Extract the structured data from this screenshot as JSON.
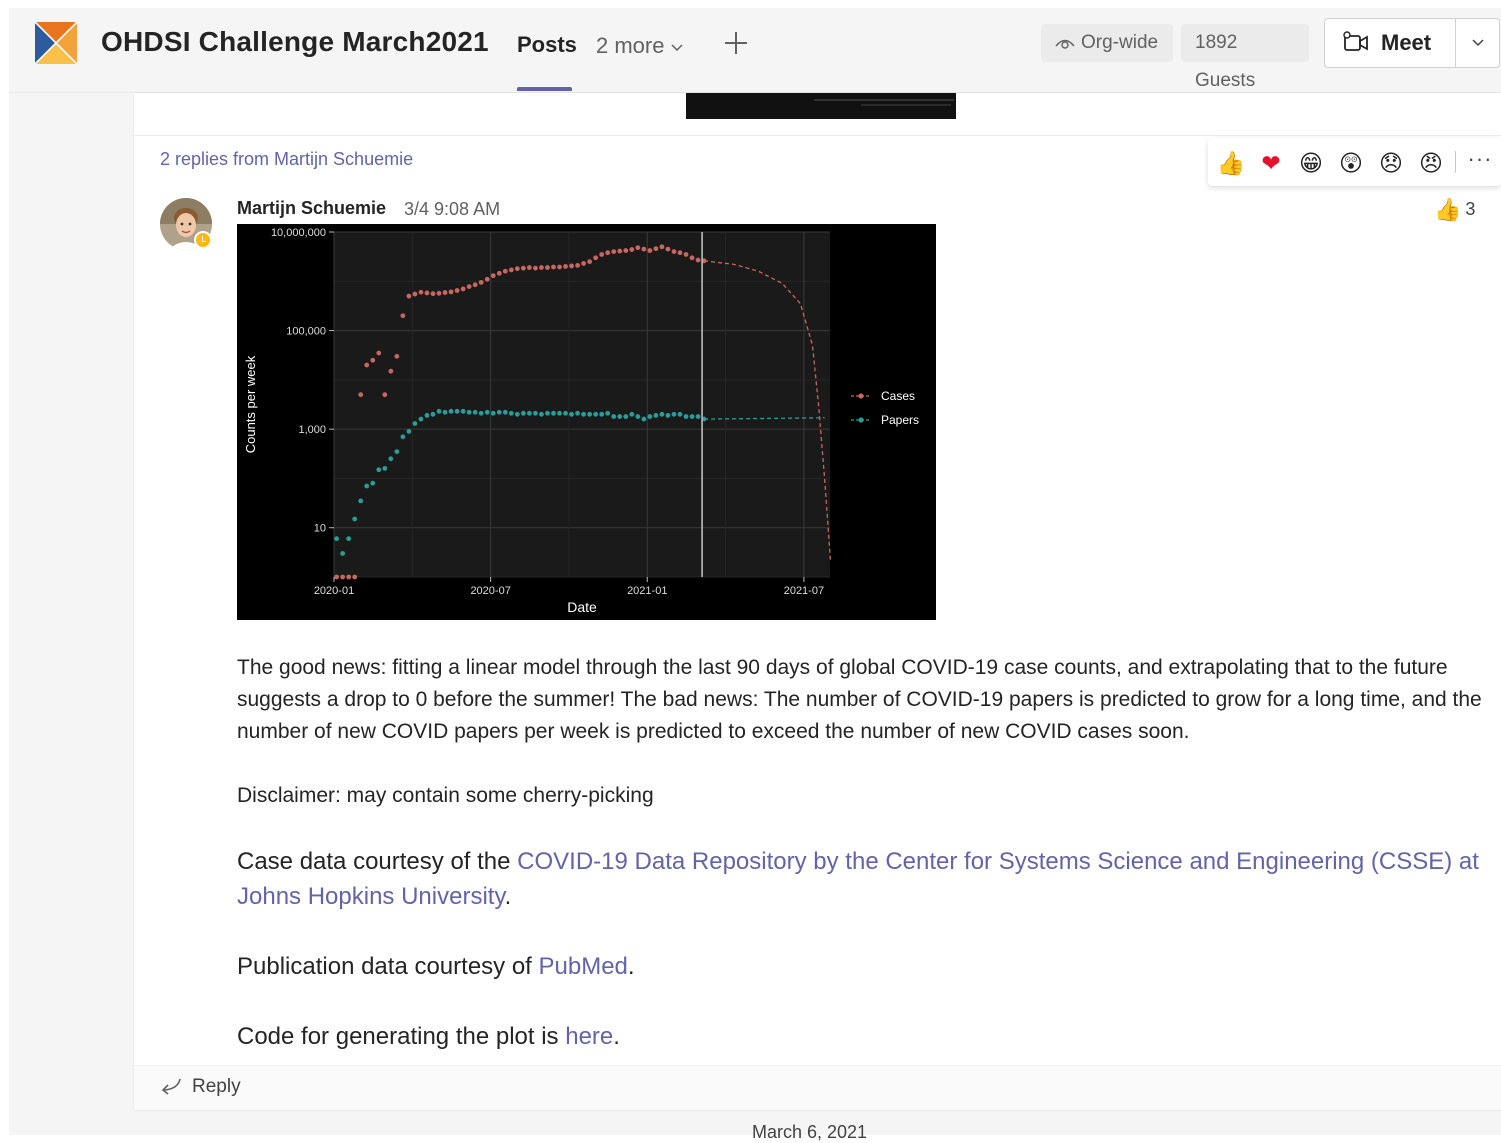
{
  "header": {
    "team_name": "OHDSI Challenge March2021",
    "tab_posts": "Posts",
    "tab_more": "2 more",
    "org_wide": "Org-wide",
    "guests": "1892 Guests",
    "meet_label": "Meet",
    "accent_color": "#6264a7"
  },
  "thread": {
    "replies_link": "2 replies from Martijn Schuemie",
    "reactions": [
      "thumbs-up",
      "heart",
      "laugh",
      "surprised",
      "sad",
      "angry"
    ],
    "message": {
      "author": "Martijn Schuemie",
      "timestamp": "3/4 9:08 AM",
      "like_count": "3",
      "paragraph1": "The good news: fitting a linear model through the last 90 days of global COVID-19 case counts, and extrapolating that to the future suggests a drop to 0 before the summer! The bad news: The number of COVID-19 papers is predicted to grow for a long time, and the number of new COVID papers per week is predicted to exceed the number of new COVID cases soon.",
      "disclaimer": "Disclaimer: may contain some cherry-picking",
      "case_prefix": "Case data courtesy of the ",
      "case_link": "COVID-19 Data Repository by the Center for Systems Science and Engineering (CSSE) at Johns Hopkins University",
      "case_suffix": ".",
      "pub_prefix": "Publication data courtesy of ",
      "pub_link": "PubMed",
      "pub_suffix": ".",
      "code_prefix": "Code for generating the plot is ",
      "code_link": "here",
      "code_suffix": "."
    },
    "reply_label": "Reply"
  },
  "date_divider": "March 6, 2021",
  "chart_data": {
    "type": "scatter",
    "xlabel": "Date",
    "ylabel": "Counts per week",
    "y_scale": "log10",
    "ylim": [
      1,
      10000000
    ],
    "xlim": [
      "2020-01",
      "2021-08"
    ],
    "x_ticks": [
      "2020-01",
      "2020-07",
      "2021-01",
      "2021-07"
    ],
    "y_ticks": [
      {
        "value": 10,
        "label": "10"
      },
      {
        "value": 1000,
        "label": "1,000"
      },
      {
        "value": 100000,
        "label": "100,000"
      },
      {
        "value": 10000000,
        "label": "10,000,000"
      }
    ],
    "vline": "2021-03-04",
    "legend_position": "right",
    "background": "#000000",
    "panel_color": "#1a1a1a",
    "grid": true,
    "series": [
      {
        "name": "Cases",
        "color": "#c8675f",
        "weeks": [
          0,
          1,
          2,
          3,
          4,
          5,
          6,
          7,
          8,
          9,
          10,
          11,
          12,
          13,
          14,
          15,
          16,
          17,
          18,
          19,
          20,
          21,
          22,
          23,
          24,
          25,
          26,
          27,
          28,
          29,
          30,
          31,
          32,
          33,
          34,
          35,
          36,
          37,
          38,
          39,
          40,
          41,
          42,
          43,
          44,
          45,
          46,
          47,
          48,
          49,
          50,
          51,
          52,
          53,
          54,
          55,
          56,
          57,
          58,
          59,
          60,
          61
        ],
        "values": [
          1,
          1,
          1,
          1,
          5000,
          20000,
          25000,
          35000,
          5000,
          15000,
          30000,
          200000,
          500000,
          550000,
          600000,
          580000,
          560000,
          570000,
          590000,
          610000,
          650000,
          700000,
          780000,
          850000,
          950000,
          1100000,
          1300000,
          1450000,
          1600000,
          1700000,
          1800000,
          1850000,
          1900000,
          1850000,
          1900000,
          1900000,
          1950000,
          1950000,
          2000000,
          2050000,
          2100000,
          2300000,
          2500000,
          3000000,
          3500000,
          3800000,
          4000000,
          4100000,
          4200000,
          4400000,
          4800000,
          4500000,
          4200000,
          4600000,
          5000000,
          4500000,
          4000000,
          3800000,
          3500000,
          3000000,
          2700000,
          2600000
        ],
        "projection": [
          {
            "week": 61,
            "value": 2600000
          },
          {
            "week": 66,
            "value": 2200000
          },
          {
            "week": 70,
            "value": 1600000
          },
          {
            "week": 74,
            "value": 900000
          },
          {
            "week": 77,
            "value": 350000
          },
          {
            "week": 79,
            "value": 50000
          },
          {
            "week": 80,
            "value": 3000
          },
          {
            "week": 81,
            "value": 100
          },
          {
            "week": 82,
            "value": 2
          }
        ]
      },
      {
        "name": "Papers",
        "color": "#2a9d98",
        "weeks": [
          0,
          1,
          2,
          3,
          4,
          5,
          6,
          7,
          8,
          9,
          10,
          11,
          12,
          13,
          14,
          15,
          16,
          17,
          18,
          19,
          20,
          21,
          22,
          23,
          24,
          25,
          26,
          27,
          28,
          29,
          30,
          31,
          32,
          33,
          34,
          35,
          36,
          37,
          38,
          39,
          40,
          41,
          42,
          43,
          44,
          45,
          46,
          47,
          48,
          49,
          50,
          51,
          52,
          53,
          54,
          55,
          56,
          57,
          58,
          59,
          60,
          61
        ],
        "values": [
          6,
          3,
          6,
          15,
          35,
          70,
          80,
          150,
          160,
          250,
          350,
          700,
          900,
          1300,
          1600,
          1900,
          2000,
          2300,
          2200,
          2300,
          2300,
          2300,
          2200,
          2200,
          2100,
          2200,
          2100,
          2200,
          2200,
          2100,
          2000,
          2100,
          2100,
          2100,
          2000,
          2100,
          2100,
          2100,
          2100,
          2000,
          2100,
          2000,
          2000,
          2000,
          2000,
          2100,
          1800,
          1800,
          1800,
          2000,
          1800,
          1600,
          1800,
          1900,
          2000,
          1900,
          2000,
          2000,
          1800,
          1800,
          1800,
          1600
        ],
        "projection": [
          {
            "week": 61,
            "value": 1600
          },
          {
            "week": 81,
            "value": 1700
          }
        ]
      }
    ]
  }
}
